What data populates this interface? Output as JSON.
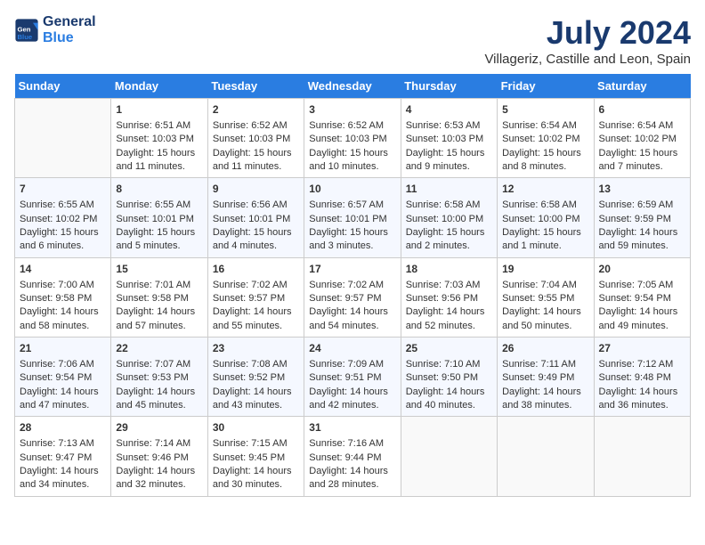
{
  "header": {
    "logo_line1": "General",
    "logo_line2": "Blue",
    "month": "July 2024",
    "location": "Villageriz, Castille and Leon, Spain"
  },
  "days_of_week": [
    "Sunday",
    "Monday",
    "Tuesday",
    "Wednesday",
    "Thursday",
    "Friday",
    "Saturday"
  ],
  "weeks": [
    [
      {
        "day": "",
        "content": ""
      },
      {
        "day": "1",
        "content": "Sunrise: 6:51 AM\nSunset: 10:03 PM\nDaylight: 15 hours\nand 11 minutes."
      },
      {
        "day": "2",
        "content": "Sunrise: 6:52 AM\nSunset: 10:03 PM\nDaylight: 15 hours\nand 11 minutes."
      },
      {
        "day": "3",
        "content": "Sunrise: 6:52 AM\nSunset: 10:03 PM\nDaylight: 15 hours\nand 10 minutes."
      },
      {
        "day": "4",
        "content": "Sunrise: 6:53 AM\nSunset: 10:03 PM\nDaylight: 15 hours\nand 9 minutes."
      },
      {
        "day": "5",
        "content": "Sunrise: 6:54 AM\nSunset: 10:02 PM\nDaylight: 15 hours\nand 8 minutes."
      },
      {
        "day": "6",
        "content": "Sunrise: 6:54 AM\nSunset: 10:02 PM\nDaylight: 15 hours\nand 7 minutes."
      }
    ],
    [
      {
        "day": "7",
        "content": "Sunrise: 6:55 AM\nSunset: 10:02 PM\nDaylight: 15 hours\nand 6 minutes."
      },
      {
        "day": "8",
        "content": "Sunrise: 6:55 AM\nSunset: 10:01 PM\nDaylight: 15 hours\nand 5 minutes."
      },
      {
        "day": "9",
        "content": "Sunrise: 6:56 AM\nSunset: 10:01 PM\nDaylight: 15 hours\nand 4 minutes."
      },
      {
        "day": "10",
        "content": "Sunrise: 6:57 AM\nSunset: 10:01 PM\nDaylight: 15 hours\nand 3 minutes."
      },
      {
        "day": "11",
        "content": "Sunrise: 6:58 AM\nSunset: 10:00 PM\nDaylight: 15 hours\nand 2 minutes."
      },
      {
        "day": "12",
        "content": "Sunrise: 6:58 AM\nSunset: 10:00 PM\nDaylight: 15 hours\nand 1 minute."
      },
      {
        "day": "13",
        "content": "Sunrise: 6:59 AM\nSunset: 9:59 PM\nDaylight: 14 hours\nand 59 minutes."
      }
    ],
    [
      {
        "day": "14",
        "content": "Sunrise: 7:00 AM\nSunset: 9:58 PM\nDaylight: 14 hours\nand 58 minutes."
      },
      {
        "day": "15",
        "content": "Sunrise: 7:01 AM\nSunset: 9:58 PM\nDaylight: 14 hours\nand 57 minutes."
      },
      {
        "day": "16",
        "content": "Sunrise: 7:02 AM\nSunset: 9:57 PM\nDaylight: 14 hours\nand 55 minutes."
      },
      {
        "day": "17",
        "content": "Sunrise: 7:02 AM\nSunset: 9:57 PM\nDaylight: 14 hours\nand 54 minutes."
      },
      {
        "day": "18",
        "content": "Sunrise: 7:03 AM\nSunset: 9:56 PM\nDaylight: 14 hours\nand 52 minutes."
      },
      {
        "day": "19",
        "content": "Sunrise: 7:04 AM\nSunset: 9:55 PM\nDaylight: 14 hours\nand 50 minutes."
      },
      {
        "day": "20",
        "content": "Sunrise: 7:05 AM\nSunset: 9:54 PM\nDaylight: 14 hours\nand 49 minutes."
      }
    ],
    [
      {
        "day": "21",
        "content": "Sunrise: 7:06 AM\nSunset: 9:54 PM\nDaylight: 14 hours\nand 47 minutes."
      },
      {
        "day": "22",
        "content": "Sunrise: 7:07 AM\nSunset: 9:53 PM\nDaylight: 14 hours\nand 45 minutes."
      },
      {
        "day": "23",
        "content": "Sunrise: 7:08 AM\nSunset: 9:52 PM\nDaylight: 14 hours\nand 43 minutes."
      },
      {
        "day": "24",
        "content": "Sunrise: 7:09 AM\nSunset: 9:51 PM\nDaylight: 14 hours\nand 42 minutes."
      },
      {
        "day": "25",
        "content": "Sunrise: 7:10 AM\nSunset: 9:50 PM\nDaylight: 14 hours\nand 40 minutes."
      },
      {
        "day": "26",
        "content": "Sunrise: 7:11 AM\nSunset: 9:49 PM\nDaylight: 14 hours\nand 38 minutes."
      },
      {
        "day": "27",
        "content": "Sunrise: 7:12 AM\nSunset: 9:48 PM\nDaylight: 14 hours\nand 36 minutes."
      }
    ],
    [
      {
        "day": "28",
        "content": "Sunrise: 7:13 AM\nSunset: 9:47 PM\nDaylight: 14 hours\nand 34 minutes."
      },
      {
        "day": "29",
        "content": "Sunrise: 7:14 AM\nSunset: 9:46 PM\nDaylight: 14 hours\nand 32 minutes."
      },
      {
        "day": "30",
        "content": "Sunrise: 7:15 AM\nSunset: 9:45 PM\nDaylight: 14 hours\nand 30 minutes."
      },
      {
        "day": "31",
        "content": "Sunrise: 7:16 AM\nSunset: 9:44 PM\nDaylight: 14 hours\nand 28 minutes."
      },
      {
        "day": "",
        "content": ""
      },
      {
        "day": "",
        "content": ""
      },
      {
        "day": "",
        "content": ""
      }
    ]
  ]
}
